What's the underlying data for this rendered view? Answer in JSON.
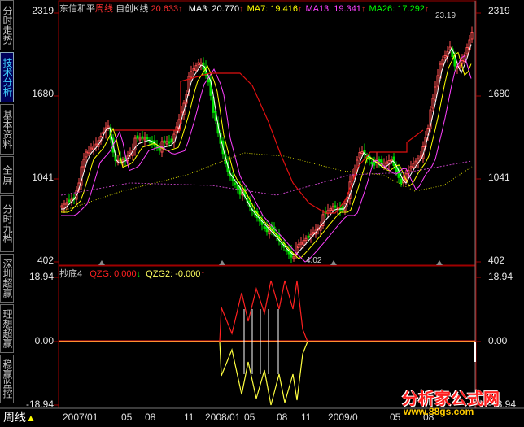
{
  "period_label": "周线",
  "stock_name": "东信和平",
  "period_tag": "周线",
  "adjust_tag": "自创K线",
  "price_value": "20.633",
  "ma": [
    {
      "label": "MA3:",
      "value": "20.770",
      "color": "#ffffff"
    },
    {
      "label": "MA7:",
      "value": "19.416",
      "color": "#ffff00"
    },
    {
      "label": "MA13:",
      "value": "19.341",
      "color": "#ff40ff"
    },
    {
      "label": "MA26:",
      "value": "17.292",
      "color": "#00ff00"
    }
  ],
  "up_arrow": "↑",
  "down_arrow": "↓",
  "indicator": {
    "name": "抄底4",
    "lines": [
      {
        "label": "QZG:",
        "value": "0.000",
        "color": "#ff2020",
        "arrow": "↓"
      },
      {
        "label": "QZG2:",
        "value": "-0.000",
        "color": "#ffff60",
        "arrow": "↑"
      }
    ]
  },
  "main_axis": {
    "top": "2319",
    "a": "1680",
    "b": "1041",
    "bottom": "402"
  },
  "ind_axis": {
    "top": "18.94",
    "mid": "0.00",
    "bottom": "-18.94"
  },
  "max_label": "23.19",
  "min_label": "4.02",
  "x_labels": [
    "2007/01",
    "05",
    "08",
    "11",
    "2008/01",
    "05",
    "08",
    "11",
    "2009/0",
    "05",
    "08"
  ],
  "side_tabs": [
    {
      "label": "分时走势",
      "active": false
    },
    {
      "label": "技术分析",
      "active": true
    },
    {
      "label": "基本资料",
      "active": false
    },
    {
      "label": "全屏",
      "active": false
    },
    {
      "label": "分时九档",
      "active": false
    },
    {
      "label": "深圳超赢",
      "active": false
    },
    {
      "label": "理想超赢",
      "active": false
    },
    {
      "label": "稳赢监控",
      "active": false
    }
  ],
  "watermark": {
    "brand": "分析家公式网",
    "url": "www.88gs.com"
  },
  "colors": {
    "up": "#ff5050",
    "down": "#00e000",
    "bg": "#000000",
    "axis": "#a00000",
    "ma3": "#ffffff",
    "ma7": "#ffff00",
    "ma13": "#ff40ff",
    "ma26": "#00ff00",
    "red_line": "#e01010"
  }
}
